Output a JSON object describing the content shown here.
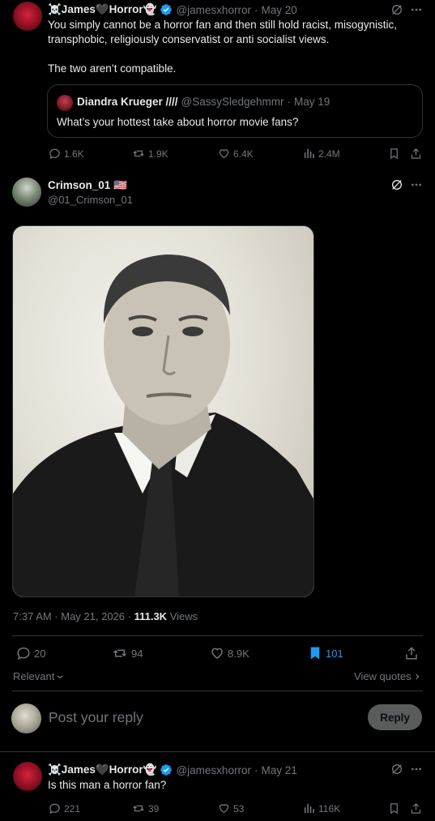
{
  "post1": {
    "name": "☠️James🖤Horror👻",
    "handle": "@jamesxhorror",
    "date": "May 20",
    "text_line1": "You simply cannot be a horror fan and then still hold racist, misogynistic,",
    "text_line2": "transphobic, religiously conservatist or anti socialist views.",
    "text_line3": "The two aren’t compatible.",
    "quote": {
      "name": "Diandra Krueger ////",
      "handle": "@SassySledgehmmr",
      "date": "May 19",
      "text": "What’s your hottest take about horror movie fans?"
    },
    "stats": {
      "replies": "1.6K",
      "reposts": "1.9K",
      "likes": "6.4K",
      "views": "2.4M"
    }
  },
  "main": {
    "name": "Crimson_01 🇺🇸",
    "handle": "@01_Crimson_01",
    "timestamp": "7:37 AM · May 21, 2026 · ",
    "views_count": "111.3K",
    "views_label": " Views",
    "stats": {
      "replies": "20",
      "reposts": "94",
      "likes": "8.9K",
      "bookmarks": "101"
    },
    "relevant_label": "Relevant",
    "view_quotes_label": "View quotes"
  },
  "reply_box": {
    "placeholder": "Post your reply",
    "button_label": "Reply"
  },
  "post2": {
    "name": "☠️James🖤Horror👻",
    "handle": "@jamesxhorror",
    "date": "May 21",
    "text": "Is this man a horror fan?",
    "stats": {
      "replies": "221",
      "reposts": "39",
      "likes": "53",
      "views": "116K"
    }
  },
  "colors": {
    "accent": "#1d9bf0",
    "muted": "#71767b",
    "divider": "#2f3336"
  }
}
